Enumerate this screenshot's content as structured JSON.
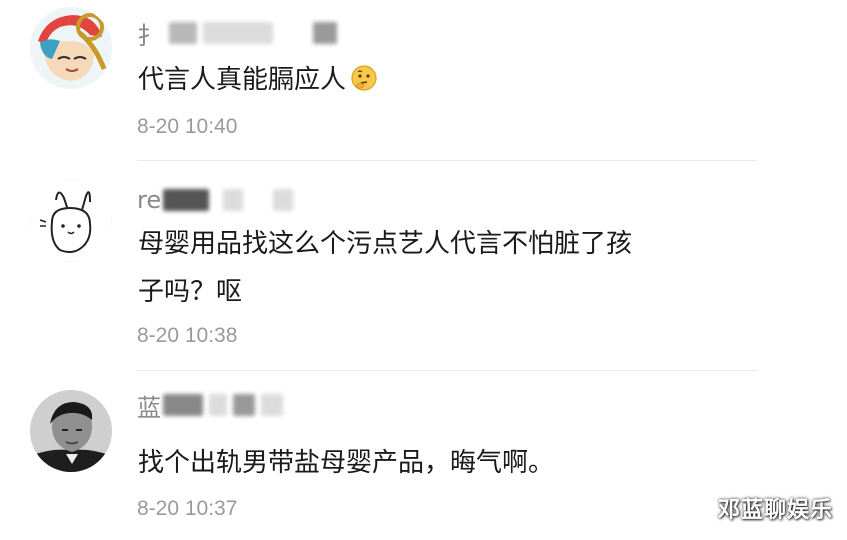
{
  "comments": [
    {
      "username_visible": "扌",
      "text": "代言人真能膈应人",
      "emoji": "thinking-face-emoji",
      "time": "8-20 10:40"
    },
    {
      "username_visible": "re",
      "text_line1": "母婴用品找这么个污点艺人代言不怕脏了孩",
      "text_line2": "子吗？呕",
      "time": "8-20 10:38"
    },
    {
      "username_visible": "蓝",
      "text": "找个出轨男带盐母婴产品，晦气啊。",
      "time": "8-20 10:37"
    }
  ],
  "watermark": "邓蓝聊娱乐",
  "colors": {
    "text": "#1a1a1a",
    "username": "#8a8a8a",
    "time": "#9a9a9a",
    "divider": "#e9e9e9",
    "background": "#ffffff"
  }
}
